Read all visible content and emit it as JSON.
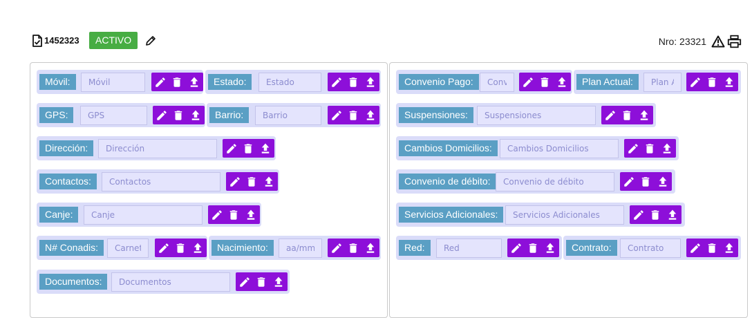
{
  "header": {
    "record_id": "1452323",
    "status": "ACTIVO",
    "status_color": "#47ad43",
    "nro_label": "Nro: 23321",
    "icons": [
      "document-check-icon",
      "pencil-icon",
      "warning-icon",
      "printer-icon"
    ]
  },
  "colors": {
    "label_bg": "#5a9fc4",
    "button_bg": "#8d0fd9",
    "group_bg": "#dadcf9",
    "input_bg": "#e4e4fd"
  },
  "left_panel": {
    "movil": {
      "label": "Móvil:",
      "placeholder": "Móvil",
      "value": ""
    },
    "estado": {
      "label": "Estado:",
      "placeholder": "Estado",
      "value": ""
    },
    "gps": {
      "label": "GPS:",
      "placeholder": "GPS",
      "value": ""
    },
    "barrio": {
      "label": "Barrio:",
      "placeholder": "Barrio",
      "value": ""
    },
    "direccion": {
      "label": "Dirección:",
      "placeholder": "Dirección",
      "value": ""
    },
    "contactos": {
      "label": "Contactos:",
      "placeholder": "Contactos",
      "value": ""
    },
    "canje": {
      "label": "Canje:",
      "placeholder": "Canje",
      "value": ""
    },
    "conadis": {
      "label": "N# Conadis:",
      "placeholder": "Carnet",
      "value": ""
    },
    "nacimiento": {
      "label": "Nacimiento:",
      "placeholder": "aa/mm/dd",
      "value": ""
    },
    "documentos": {
      "label": "Documentos:",
      "placeholder": "Documentos",
      "value": ""
    }
  },
  "right_panel": {
    "convenio_pago": {
      "label": "Convenio Pago:",
      "placeholder": "Convenio Pago",
      "value": ""
    },
    "plan_actual": {
      "label": "Plan Actual:",
      "placeholder": "Plan Actual",
      "value": ""
    },
    "suspensiones": {
      "label": "Suspensiones:",
      "placeholder": "Suspensiones",
      "value": ""
    },
    "cambios_domicilios": {
      "label": "Cambios Domicilios:",
      "placeholder": "Cambios Domicilios",
      "value": ""
    },
    "convenio_debito": {
      "label": "Convenio de débito:",
      "placeholder": "Convenio de débito",
      "value": ""
    },
    "servicios_adicionales": {
      "label": "Servicios Adicionales:",
      "placeholder": "Servicios Adicionales",
      "value": ""
    },
    "red": {
      "label": "Red:",
      "placeholder": "Red",
      "value": ""
    },
    "contrato": {
      "label": "Contrato:",
      "placeholder": "Contrato",
      "value": ""
    }
  }
}
